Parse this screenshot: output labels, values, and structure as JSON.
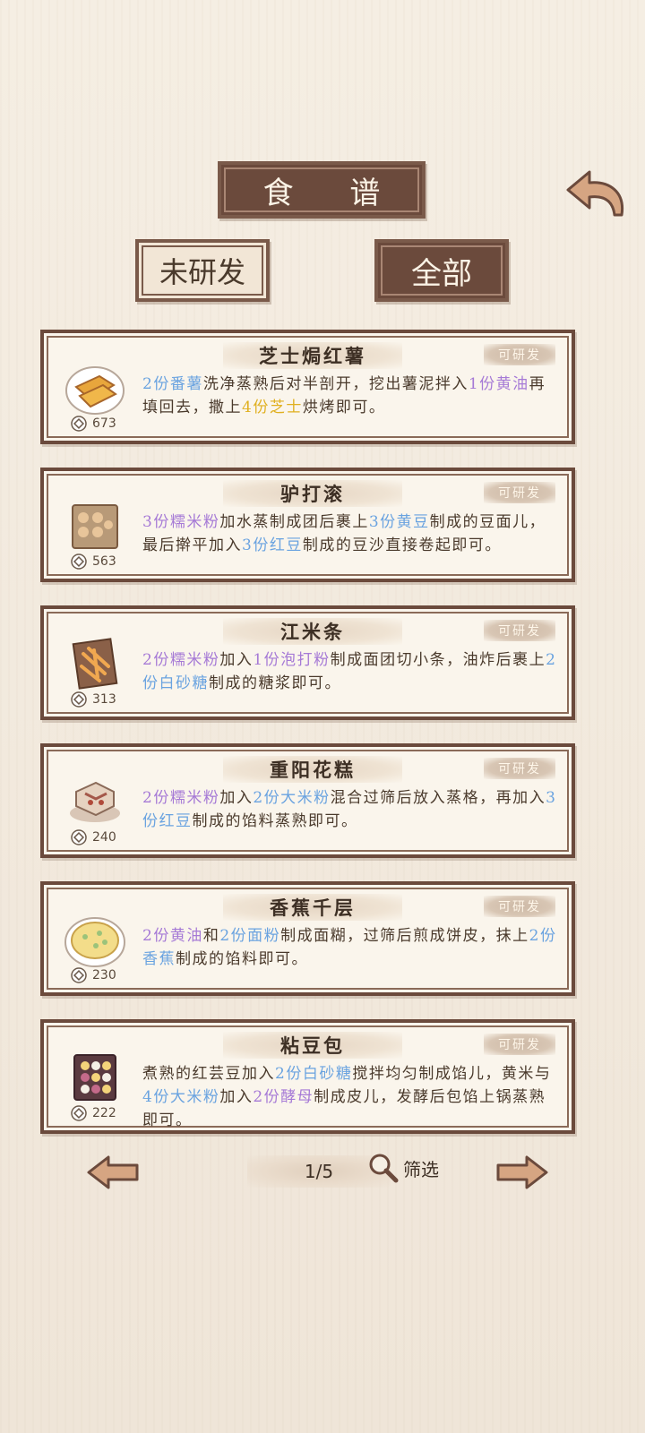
{
  "header": {
    "title": "食 谱"
  },
  "tabs": {
    "unresearched": "未研发",
    "all": "全部"
  },
  "recipes": [
    {
      "name": "芝士焗红薯",
      "badge": "可研发",
      "coins": "673",
      "desc": [
        {
          "t": "2份番薯",
          "c": "blue"
        },
        {
          "t": "洗净蒸熟后对半剖开，挖出薯泥拌入"
        },
        {
          "t": "1份黄油",
          "c": "purple"
        },
        {
          "t": "再填回去，撒上"
        },
        {
          "t": "4份芝士",
          "c": "yellow"
        },
        {
          "t": "烘烤即可。"
        }
      ]
    },
    {
      "name": "驴打滚",
      "badge": "可研发",
      "coins": "563",
      "desc": [
        {
          "t": "3份糯米粉",
          "c": "purple"
        },
        {
          "t": "加水蒸制成团后裹上"
        },
        {
          "t": "3份黄豆",
          "c": "blue"
        },
        {
          "t": "制成的豆面儿，最后擀平加入"
        },
        {
          "t": "3份红豆",
          "c": "blue"
        },
        {
          "t": "制成的豆沙直接卷起即可。"
        }
      ]
    },
    {
      "name": "江米条",
      "badge": "可研发",
      "coins": "313",
      "desc": [
        {
          "t": "2份糯米粉",
          "c": "purple"
        },
        {
          "t": "加入"
        },
        {
          "t": "1份泡打粉",
          "c": "purple"
        },
        {
          "t": "制成面团切小条，油炸后裹上"
        },
        {
          "t": "2份白砂糖",
          "c": "blue"
        },
        {
          "t": "制成的糖浆即可。"
        }
      ]
    },
    {
      "name": "重阳花糕",
      "badge": "可研发",
      "coins": "240",
      "desc": [
        {
          "t": "2份糯米粉",
          "c": "purple"
        },
        {
          "t": "加入"
        },
        {
          "t": "2份大米粉",
          "c": "blue"
        },
        {
          "t": "混合过筛后放入蒸格，再加入"
        },
        {
          "t": "3份红豆",
          "c": "blue"
        },
        {
          "t": "制成的馅料蒸熟即可。"
        }
      ]
    },
    {
      "name": "香蕉千层",
      "badge": "可研发",
      "coins": "230",
      "desc": [
        {
          "t": "2份黄油",
          "c": "purple"
        },
        {
          "t": "和"
        },
        {
          "t": "2份面粉",
          "c": "blue"
        },
        {
          "t": "制成面糊，过筛后煎成饼皮，抹上"
        },
        {
          "t": "2份香蕉",
          "c": "blue"
        },
        {
          "t": "制成的馅料即可。"
        }
      ]
    },
    {
      "name": "粘豆包",
      "badge": "可研发",
      "coins": "222",
      "desc": [
        {
          "t": "煮熟的红芸豆加入"
        },
        {
          "t": "2份白砂糖",
          "c": "blue"
        },
        {
          "t": "搅拌均匀制成馅儿，黄米与"
        },
        {
          "t": "4份大米粉",
          "c": "blue"
        },
        {
          "t": "加入"
        },
        {
          "t": "2份酵母",
          "c": "purple"
        },
        {
          "t": "制成皮儿，发酵后包馅上锅蒸熟即可。"
        }
      ]
    }
  ],
  "pager": {
    "page": "1/5",
    "filter_label": "筛选"
  },
  "colors": {
    "blue": "#6aa3e0",
    "purple": "#a67ad6",
    "yellow": "#e0b020",
    "frame": "#6b4a3c"
  }
}
